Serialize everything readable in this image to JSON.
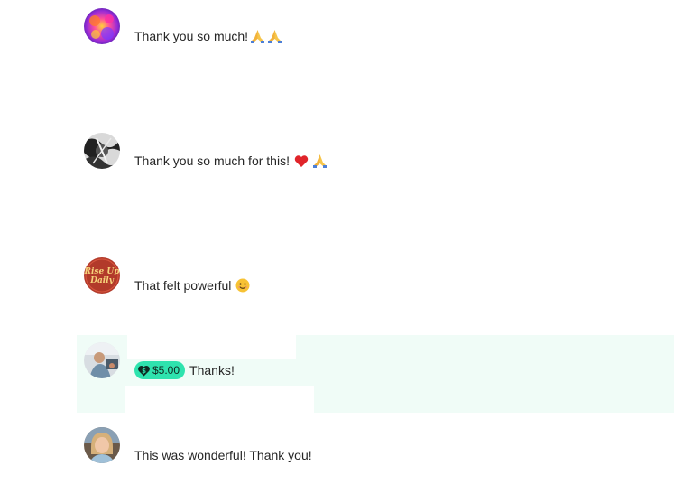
{
  "comments": [
    {
      "text": "Thank you so much!",
      "emojis": [
        "folded-hands",
        "folded-hands"
      ]
    },
    {
      "text": "Thank you so much for this!",
      "emojis": [
        "red-heart",
        "folded-hands"
      ]
    },
    {
      "text": "That felt powerful",
      "emojis": [
        "smiling-face"
      ],
      "avatar_text": [
        "Rise Up",
        "Daily"
      ]
    },
    {
      "text": "Thanks!",
      "super_thanks": {
        "amount": "$5.00"
      }
    },
    {
      "text": "This was wonderful! Thank you!"
    }
  ],
  "colors": {
    "text": "#262626",
    "super_thanks_pill": "#2ee3ae",
    "highlight": "#f0fcf7",
    "rise_up_avatar": "#b23a2a"
  }
}
